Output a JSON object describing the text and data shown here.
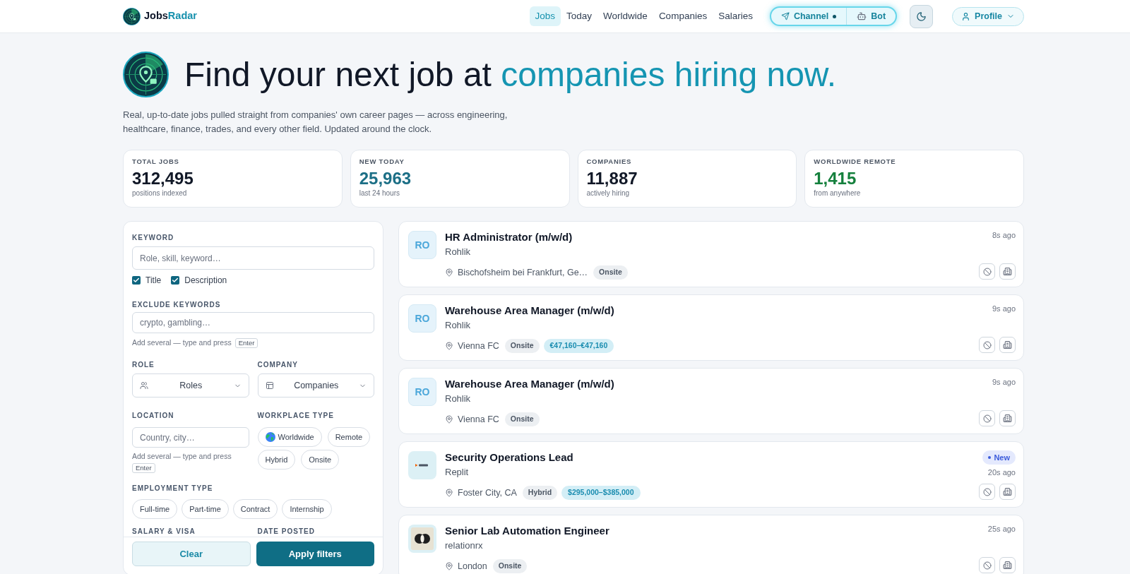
{
  "header": {
    "brand": {
      "first": "Jobs",
      "second": "Radar"
    },
    "nav": [
      {
        "label": "Jobs",
        "selected": true
      },
      {
        "label": "Today",
        "selected": false
      },
      {
        "label": "Worldwide",
        "selected": false
      },
      {
        "label": "Companies",
        "selected": false
      },
      {
        "label": "Salaries",
        "selected": false
      }
    ],
    "links": [
      {
        "kind": "channel",
        "label": "Channel"
      },
      {
        "kind": "bot",
        "label": "Bot"
      }
    ],
    "profile": {
      "label": "Profile"
    }
  },
  "hero": {
    "lead": "Find your next job at",
    "highlight": "companies hiring now.",
    "description": "Real, up-to-date jobs pulled straight from companies' own career pages — across engineering, healthcare, finance, trades, and every other field. Updated around the clock."
  },
  "stats": [
    {
      "label": "TOTAL JOBS",
      "value": "312,495",
      "note": "positions indexed",
      "color": "#111827"
    },
    {
      "label": "NEW TODAY",
      "value": "25,963",
      "note": "last 24 hours",
      "color": "#1c6f86"
    },
    {
      "label": "COMPANIES",
      "value": "11,887",
      "note": "actively hiring",
      "color": "#111827"
    },
    {
      "label": "WORLDWIDE REMOTE",
      "value": "1,415",
      "note": "from anywhere",
      "color": "#15803d"
    }
  ],
  "filters": {
    "keyword": {
      "label": "KEYWORD",
      "placeholder": "Role, skill, keyword…",
      "options": [
        {
          "label": "Title",
          "checked": true
        },
        {
          "label": "Description",
          "checked": true
        }
      ]
    },
    "exclude": {
      "label": "EXCLUDE KEYWORDS",
      "placeholder": "crypto, gambling…",
      "hint": "Add several — type and press",
      "key": "Enter"
    },
    "role": {
      "label": "ROLE",
      "placeholder": "Roles"
    },
    "company": {
      "label": "COMPANY",
      "placeholder": "Companies"
    },
    "location": {
      "label": "LOCATION",
      "placeholder": "Country, city…",
      "hint": "Add several — type and press",
      "key": "Enter"
    },
    "workplace": {
      "label": "WORKPLACE TYPE",
      "options": [
        {
          "kind": "globe",
          "label": "Worldwide",
          "selected": false
        },
        {
          "kind": "text",
          "label": "Remote",
          "selected": false
        },
        {
          "kind": "text",
          "label": "Hybrid",
          "selected": false
        },
        {
          "kind": "text",
          "label": "Onsite",
          "selected": false
        }
      ]
    },
    "employment": {
      "label": "EMPLOYMENT TYPE",
      "options": [
        {
          "label": "Full-time",
          "selected": false
        },
        {
          "label": "Part-time",
          "selected": false
        },
        {
          "label": "Contract",
          "selected": false
        },
        {
          "label": "Internship",
          "selected": false
        }
      ]
    },
    "more": [
      "SALARY & VISA",
      "DATE POSTED"
    ],
    "clear": "Clear",
    "apply": "Apply filters"
  },
  "jobs": [
    {
      "logo": {
        "kind": "initials",
        "text": "RO"
      },
      "title": "HR Administrator (m/w/d)",
      "company": "Rohlik",
      "location": "Bischofsheim bei Frankfurt, Ge…",
      "tags": [
        {
          "kind": "workplace",
          "text": "Onsite"
        }
      ],
      "posted": "8s ago"
    },
    {
      "logo": {
        "kind": "initials",
        "text": "RO"
      },
      "title": "Warehouse Area Manager (m/w/d)",
      "company": "Rohlik",
      "location": "Vienna FC",
      "tags": [
        {
          "kind": "workplace",
          "text": "Onsite"
        },
        {
          "kind": "salary",
          "text": "€47,160–€47,160"
        }
      ],
      "posted": "9s ago"
    },
    {
      "logo": {
        "kind": "initials",
        "text": "RO"
      },
      "title": "Warehouse Area Manager (m/w/d)",
      "company": "Rohlik",
      "location": "Vienna FC",
      "tags": [
        {
          "kind": "workplace",
          "text": "Onsite"
        }
      ],
      "posted": "9s ago"
    },
    {
      "logo": {
        "kind": "chevron"
      },
      "title": "Security Operations Lead",
      "company": "Replit",
      "location": "Foster City, CA",
      "tags": [
        {
          "kind": "workplace",
          "text": "Hybrid"
        },
        {
          "kind": "salary",
          "text": "$295,000–$385,000"
        }
      ],
      "badge": "New",
      "posted": "20s ago"
    },
    {
      "logo": {
        "kind": "circles"
      },
      "title": "Senior Lab Automation Engineer",
      "company": "relationrx",
      "location": "London",
      "tags": [
        {
          "kind": "workplace",
          "text": "Onsite"
        }
      ],
      "posted": "25s ago"
    }
  ]
}
